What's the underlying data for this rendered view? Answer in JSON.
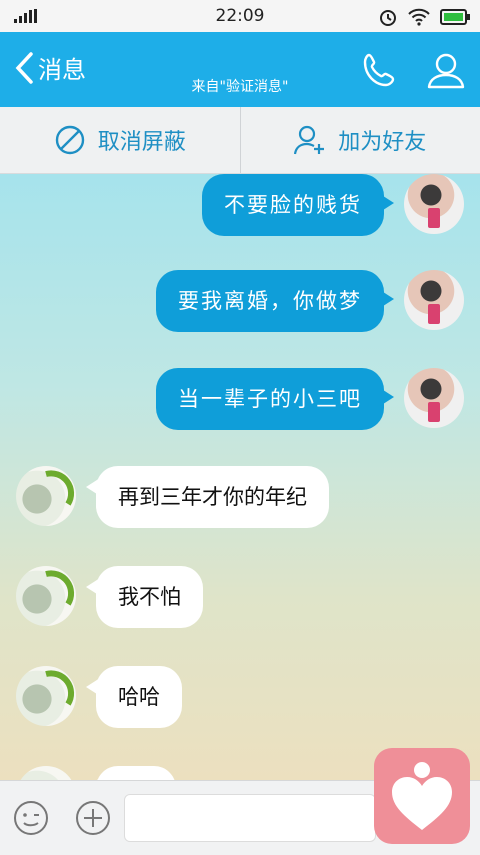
{
  "status_bar": {
    "time": "22:09"
  },
  "header": {
    "back_label": "消息",
    "subtitle": "来自\"验证消息\""
  },
  "actions": {
    "unblock_label": "取消屏蔽",
    "add_friend_label": "加为好友"
  },
  "messages": [
    {
      "sender": "me",
      "text": "不要脸的贱货"
    },
    {
      "sender": "me",
      "text": "要我离婚，你做梦"
    },
    {
      "sender": "me",
      "text": "当一辈子的小三吧"
    },
    {
      "sender": "them",
      "text": "再到三年才你的年纪"
    },
    {
      "sender": "them",
      "text": "我不怕"
    },
    {
      "sender": "them",
      "text": "哈哈"
    }
  ],
  "colors": {
    "header_blue": "#1eaee8",
    "my_bubble": "#0f9ed9",
    "their_bubble": "#ffffff",
    "action_text": "#1e8fc4",
    "heart_button": "#ef8f98"
  }
}
